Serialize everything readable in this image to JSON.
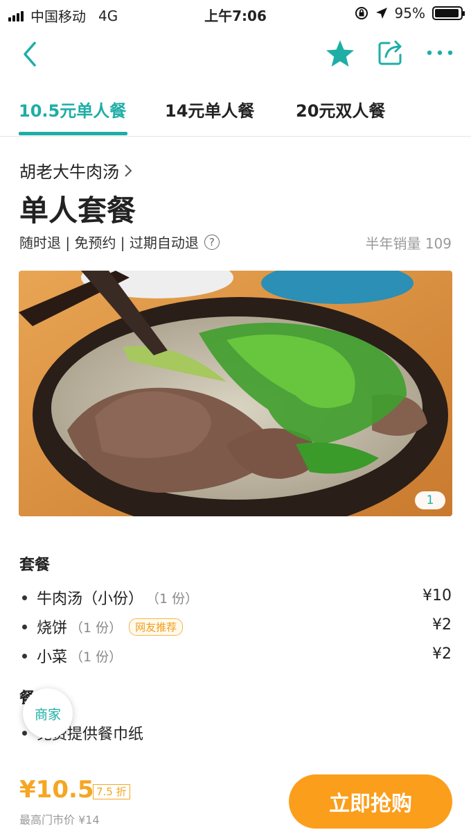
{
  "status_bar": {
    "carrier": "中国移动",
    "network": "4G",
    "time": "上午7:06",
    "battery": "95%",
    "battery_level": 0.95
  },
  "nav": {
    "icons": [
      "back-arrow-icon",
      "star-icon",
      "share-icon",
      "more-icon"
    ],
    "accent_color": "#1eaea6"
  },
  "tabs": [
    {
      "label": "10.5元单人餐",
      "active": true
    },
    {
      "label": "14元单人餐",
      "active": false
    },
    {
      "label": "20元双人餐",
      "active": false
    }
  ],
  "deal": {
    "shop_name": "胡老大牛肉汤",
    "title": "单人套餐",
    "tags": "随时退 | 免预约 | 过期自动退",
    "sales": "半年销量 109",
    "image_counter": "1"
  },
  "package": {
    "section_title": "套餐",
    "items": [
      {
        "name": "牛肉汤（小份）",
        "qty": "（1 份）",
        "badge": "",
        "price": "¥10"
      },
      {
        "name": "烧饼",
        "qty": "（1 份）",
        "badge": "网友推荐",
        "price": "¥2"
      },
      {
        "name": "小菜",
        "qty": "（1 份）",
        "badge": "",
        "price": "¥2"
      }
    ]
  },
  "notes": {
    "section_title": "餐",
    "note_text": "免费提供餐巾纸"
  },
  "merchant_button": "商家",
  "bottom": {
    "price": "¥10.5",
    "discount": "7.5 折",
    "original_price": "最高门市价 ¥14",
    "buy_button": "立即抢购",
    "accent_color": "#f5a623"
  }
}
